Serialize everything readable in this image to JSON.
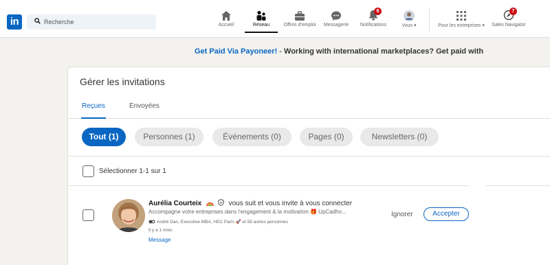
{
  "nav": {
    "logo": "in",
    "search_placeholder": "Recherche",
    "items": [
      {
        "label": "Accueil",
        "icon": "home-icon"
      },
      {
        "label": "Réseau",
        "icon": "network-icon",
        "active": true
      },
      {
        "label": "Offres d'emploi",
        "icon": "briefcase-icon"
      },
      {
        "label": "Messagerie",
        "icon": "messaging-icon"
      },
      {
        "label": "Notifications",
        "icon": "bell-icon",
        "badge": "8"
      },
      {
        "label": "Vous ▾",
        "icon": "me-avatar-icon"
      },
      {
        "label": "Pour les entreprises ▾",
        "icon": "grid-icon"
      },
      {
        "label": "Sales Navigator",
        "icon": "compass-icon",
        "badge": "7"
      }
    ]
  },
  "promo": {
    "link": "Get Paid Via Payoneer!",
    "dash": " - ",
    "text": "Working with international marketplaces? Get paid with"
  },
  "invitations": {
    "title": "Gérer les invitations",
    "tabs": [
      {
        "label": "Reçues",
        "active": true
      },
      {
        "label": "Envoyées",
        "active": false
      }
    ],
    "filters": [
      {
        "label": "Tout (1)",
        "active": true
      },
      {
        "label": "Personnes (1)"
      },
      {
        "label": "Événements (0)"
      },
      {
        "label": "Pages (0)"
      },
      {
        "label": "Newsletters (0)"
      }
    ],
    "select_label": "Sélectionner 1-1 sur 1",
    "items": [
      {
        "name": "Aurélia Courteix",
        "text": "vous suit et vous invite à vous connecter",
        "headline": "Accompagne votre entreprises dans l'engagement & la motivation 🎁 UpCadho...",
        "mutual": "André Dan, Executive MBA, HEC Paris 🚀 et 58 autres personnes",
        "time": "Il y a 1 mois",
        "message": "Message",
        "ignore": "Ignorer",
        "accept": "Accepter"
      }
    ]
  },
  "colors": {
    "brand": "#0a66c2",
    "badge": "#cc1016",
    "background": "#f3f2ef"
  }
}
